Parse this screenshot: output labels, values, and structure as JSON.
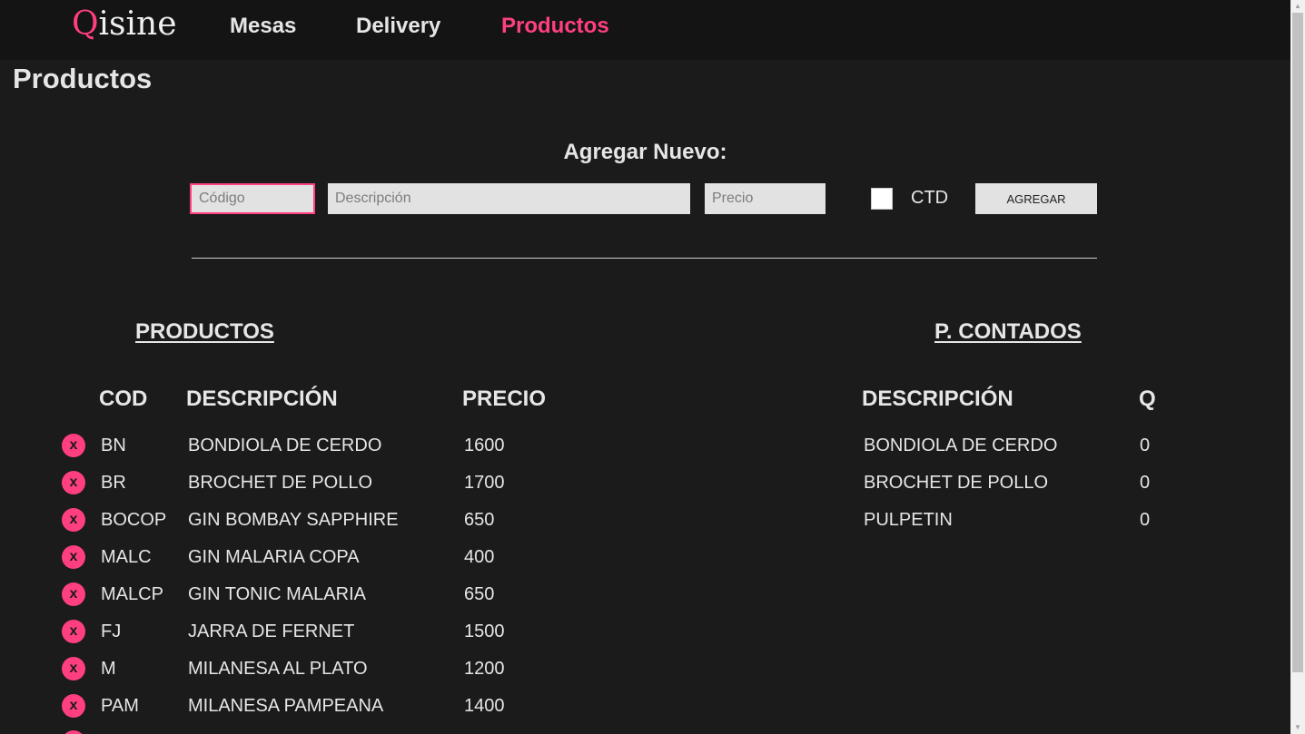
{
  "app": {
    "logo_q": "Q",
    "logo_rest": "isine"
  },
  "nav": {
    "items": [
      {
        "label": "Mesas"
      },
      {
        "label": "Delivery"
      },
      {
        "label": "Productos"
      }
    ],
    "active": "Productos"
  },
  "page": {
    "title": "Productos"
  },
  "add_form": {
    "title": "Agregar Nuevo:",
    "codigo_placeholder": "Código",
    "descripcion_placeholder": "Descripción",
    "precio_placeholder": "Precio",
    "ctd_label": "CTD",
    "ctd_checked": false,
    "submit_label": "AGREGAR"
  },
  "productos": {
    "title": "PRODUCTOS",
    "headers": [
      "COD",
      "DESCRIPCIÓN",
      "PRECIO"
    ],
    "delete_label": "x",
    "rows": [
      {
        "cod": "BN",
        "descripcion": "BONDIOLA DE CERDO",
        "precio": "1600"
      },
      {
        "cod": "BR",
        "descripcion": "BROCHET DE POLLO",
        "precio": "1700"
      },
      {
        "cod": "BOCOP",
        "descripcion": "GIN BOMBAY SAPPHIRE",
        "precio": "650"
      },
      {
        "cod": "MALC",
        "descripcion": "GIN MALARIA COPA",
        "precio": "400"
      },
      {
        "cod": "MALCP",
        "descripcion": "GIN TONIC MALARIA",
        "precio": "650"
      },
      {
        "cod": "FJ",
        "descripcion": "JARRA DE FERNET",
        "precio": "1500"
      },
      {
        "cod": "M",
        "descripcion": "MILANESA AL PLATO",
        "precio": "1200"
      },
      {
        "cod": "PAM",
        "descripcion": "MILANESA PAMPEANA",
        "precio": "1400"
      }
    ]
  },
  "contados": {
    "title": "P. CONTADOS",
    "headers": [
      "DESCRIPCIÓN",
      "Q"
    ],
    "rows": [
      {
        "descripcion": "BONDIOLA DE CERDO",
        "q": "0"
      },
      {
        "descripcion": "BROCHET DE POLLO",
        "q": "0"
      },
      {
        "descripcion": "PULPETIN",
        "q": "0"
      }
    ]
  },
  "colors": {
    "accent": "#ff3f7f",
    "background": "#1b1b1b",
    "nav_background": "#141414",
    "text": "#e6e6e6"
  }
}
